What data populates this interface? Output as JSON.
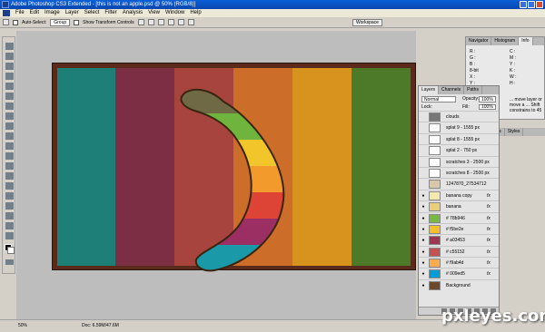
{
  "titlebar": {
    "text": "Adobe Photoshop CS3 Extended - [this is not an apple.psd @ 50% (RGB/8)]"
  },
  "menu": [
    "File",
    "Edit",
    "Image",
    "Layer",
    "Select",
    "Filter",
    "Analysis",
    "View",
    "Window",
    "Help"
  ],
  "options": {
    "auto_select": "Auto-Select:",
    "group": "Group",
    "transform": "Show Transform Controls",
    "workspace": "Workspace"
  },
  "status": {
    "zoom": "50%",
    "doc": "Doc: 6.59M/47.6M"
  },
  "navigator": {
    "tabs": [
      "Navigator",
      "Histogram",
      "Info"
    ],
    "info_labels": [
      "R :",
      "G :",
      "B :",
      "8-bit",
      "X :",
      "Y :"
    ],
    "info_labels2": [
      "C :",
      "M :",
      "Y :",
      "K :",
      "W :",
      "H :"
    ],
    "hint": "... move layer or move a ... Shift constrains to 45"
  },
  "side_tabs": [
    "Paths",
    "Styles"
  ],
  "layers_panel": {
    "tabs": [
      "Layers",
      "Channels",
      "Paths"
    ],
    "blend": "Normal",
    "opacity_label": "Opacity:",
    "opacity": "100%",
    "lock_label": "Lock:",
    "fill_label": "Fill:",
    "fill": "100%",
    "layers": [
      {
        "name": "clouds",
        "visible": false,
        "fx": false,
        "thumb": "#777777",
        "indent": false
      },
      {
        "name": "splat 9 - 1555 px",
        "visible": false,
        "fx": false,
        "thumb": "#ffffff",
        "indent": false
      },
      {
        "name": "splat 8 - 1555 px",
        "visible": false,
        "fx": false,
        "thumb": "#ffffff",
        "indent": false
      },
      {
        "name": "splat 2 - 750 px",
        "visible": false,
        "fx": false,
        "thumb": "#ffffff",
        "indent": false
      },
      {
        "name": "scratches 3 - 2500 px",
        "visible": false,
        "fx": false,
        "thumb": "#ffffff",
        "indent": false
      },
      {
        "name": "scratches 8 - 2500 px",
        "visible": false,
        "fx": false,
        "thumb": "#ffffff",
        "indent": false
      },
      {
        "name": "1247870_27534712",
        "visible": false,
        "fx": false,
        "thumb": "#d8c7a8",
        "indent": false
      },
      {
        "name": "banana copy",
        "visible": true,
        "fx": true,
        "thumb": "#f4e7b0",
        "indent": false
      },
      {
        "name": "banana",
        "visible": true,
        "fx": true,
        "thumb": "#e8d07a",
        "indent": false
      },
      {
        "name": "# 78b946",
        "visible": true,
        "fx": true,
        "thumb": "#78b946",
        "indent": false
      },
      {
        "name": "# f5be2e",
        "visible": true,
        "fx": true,
        "thumb": "#f5be2e",
        "indent": false
      },
      {
        "name": "# a03453",
        "visible": true,
        "fx": true,
        "thumb": "#a03453",
        "indent": false
      },
      {
        "name": "# c55152",
        "visible": true,
        "fx": true,
        "thumb": "#c55152",
        "indent": false
      },
      {
        "name": "# f9ab4d",
        "visible": true,
        "fx": true,
        "thumb": "#f9ab4d",
        "indent": false
      },
      {
        "name": "# 009ed5",
        "visible": true,
        "fx": true,
        "thumb": "#009ed5",
        "indent": false
      },
      {
        "name": "Background",
        "visible": true,
        "fx": false,
        "thumb": "#6b4a2e",
        "indent": false
      }
    ]
  },
  "canvas": {
    "stripe_colors": [
      "#1d7f78",
      "#7c2f44",
      "#a8443e",
      "#cc6e2a",
      "#d8921e",
      "#4d7a28"
    ],
    "banana_colors": [
      "#6fb43c",
      "#f2c52a",
      "#f29a2c",
      "#dd4436",
      "#9b2f63",
      "#1a9aa8"
    ]
  },
  "watermark": "pxleyes.com"
}
